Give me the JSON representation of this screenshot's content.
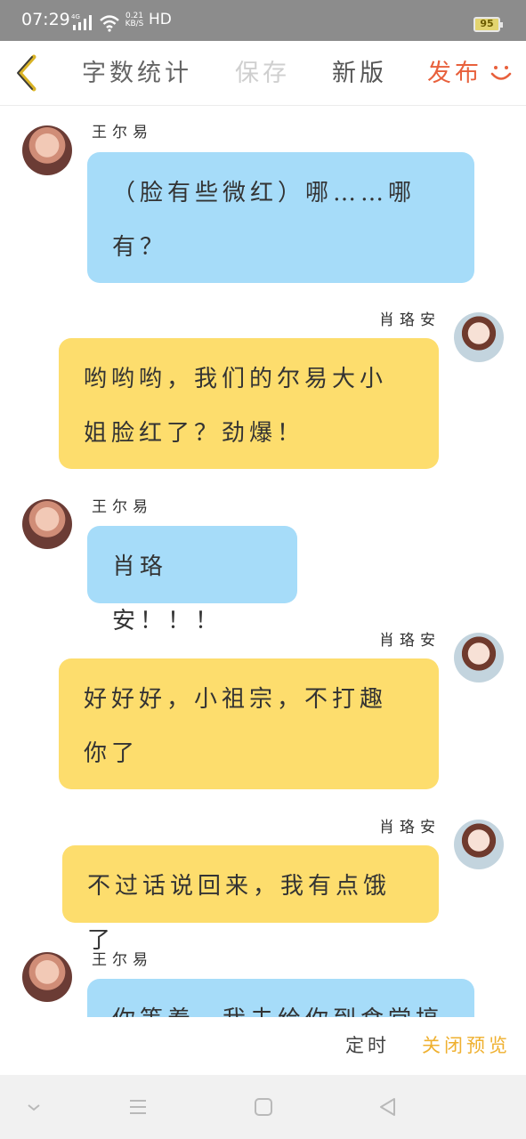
{
  "status_bar": {
    "time": "07:29",
    "network": "4G",
    "speed_top": "0.21",
    "speed_bottom": "KB/S",
    "hd": "HD",
    "battery": "95"
  },
  "toolbar": {
    "word_count": "字数统计",
    "save": "保存",
    "new_version": "新版",
    "publish": "发布"
  },
  "messages": [
    {
      "side": "left",
      "name": "王尔易",
      "text": "（脸有些微红）哪……哪有？",
      "color": "#a6dcf9"
    },
    {
      "side": "right",
      "name": "肖珞安",
      "text": "哟哟哟，我们的尔易大小姐脸红了？劲爆！",
      "color": "#fddd6d"
    },
    {
      "side": "left",
      "name": "王尔易",
      "text": "肖珞安！！！",
      "color": "#a6dcf9"
    },
    {
      "side": "right",
      "name": "肖珞安",
      "text": "好好好，小祖宗，不打趣你了",
      "color": "#fddd6d"
    },
    {
      "side": "right",
      "name": "肖珞安",
      "text": "不过话说回来，我有点饿了",
      "color": "#fddd6d"
    },
    {
      "side": "left",
      "name": "王尔易",
      "text": "你等着，我去给你到食堂搞",
      "color": "#a6dcf9"
    }
  ],
  "bottom_actions": {
    "timer": "定时",
    "close_preview": "关闭预览"
  },
  "icons": {
    "back": "chevron-left-icon",
    "smile": "smile-icon",
    "nav_down": "chevron-down-icon",
    "nav_menu": "menu-icon",
    "nav_home": "square-home-icon",
    "nav_back": "triangle-back-icon"
  }
}
